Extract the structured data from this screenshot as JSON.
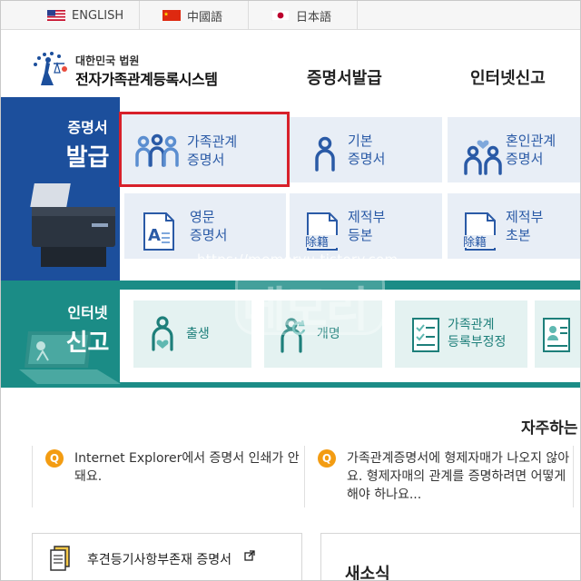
{
  "lang_bar": {
    "items": [
      {
        "label": "ENGLISH",
        "flag": "us-flag-icon"
      },
      {
        "label": "中國語",
        "flag": "china-flag-icon"
      },
      {
        "label": "日本語",
        "flag": "japan-flag-icon"
      }
    ]
  },
  "header": {
    "org": "대한민국 법원",
    "system_name": "전자가족관계등록시스템",
    "nav": [
      "증명서발급",
      "인터넷신고"
    ]
  },
  "certificate_section": {
    "title_small": "증명서",
    "title_big": "발급",
    "cards": [
      {
        "line1": "가족관계",
        "line2": "증명서",
        "icon": "family-icon",
        "selected": true
      },
      {
        "line1": "기본",
        "line2": "증명서",
        "icon": "person-icon",
        "selected": false
      },
      {
        "line1": "혼인관계",
        "line2": "증명서",
        "icon": "couple-heart-icon",
        "selected": false
      },
      {
        "line1": "영문",
        "line2": "증명서",
        "icon": "english-document-icon",
        "selected": false
      },
      {
        "line1": "제적부",
        "line2": "등본",
        "icon": "removed-register-icon",
        "icon_text": "除籍",
        "selected": false
      },
      {
        "line1": "제적부",
        "line2": "초본",
        "icon": "removed-register-icon",
        "icon_text": "除籍",
        "selected": false
      }
    ]
  },
  "report_section": {
    "title_small": "인터넷",
    "title_big": "신고",
    "cards": [
      {
        "line1": "출생",
        "line2": "",
        "icon": "birth-icon"
      },
      {
        "line1": "개명",
        "line2": "",
        "icon": "rename-icon"
      },
      {
        "line1": "가족관계",
        "line2": "등록부정정",
        "icon": "checklist-icon"
      },
      {
        "line1": "",
        "line2": "",
        "icon": "id-card-icon"
      }
    ]
  },
  "watermark": {
    "url": "https://memoryu.tistory.com",
    "text": "메모리"
  },
  "faq": {
    "title": "자주하는",
    "items": [
      {
        "badge": "Q",
        "text": "Internet Explorer에서 증명서 인쇄가 안돼요."
      },
      {
        "badge": "Q",
        "text": "가족관계증명서에 형제자매가 나오지 않아요. 형제자매의 관계를 증명하려면 어떻게 해야 하나요..."
      }
    ]
  },
  "bottom": {
    "link_text": "후견등기사항부존재 증명서",
    "link_icon": "external-link-icon",
    "news_title": "새소식"
  },
  "colors": {
    "blue_band": "#1c4f9c",
    "green_band": "#1b8c86",
    "card_blue_bg": "#e8eef6",
    "card_green_bg": "#e4f2f1",
    "selection_red": "#d8202a",
    "faq_badge": "#f39c12"
  }
}
